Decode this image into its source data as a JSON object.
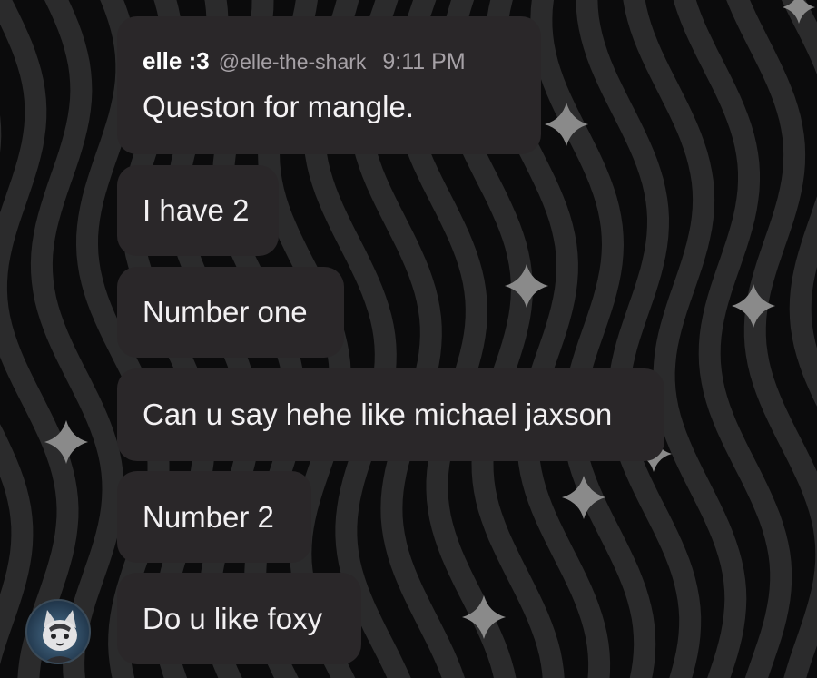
{
  "message_header": {
    "author": "elle :3",
    "handle": "@elle-the-shark",
    "time": "9:11 PM"
  },
  "messages": [
    "Queston for mangle.",
    "I have 2",
    "Number one",
    "Can u say hehe like michael jaxson",
    "Number 2",
    "Do u like foxy"
  ],
  "theme": {
    "bubble": "#2a2729",
    "background": "#0b0b0c",
    "wave": "#2b2b2c",
    "sparkle": "#8a8a8a"
  }
}
